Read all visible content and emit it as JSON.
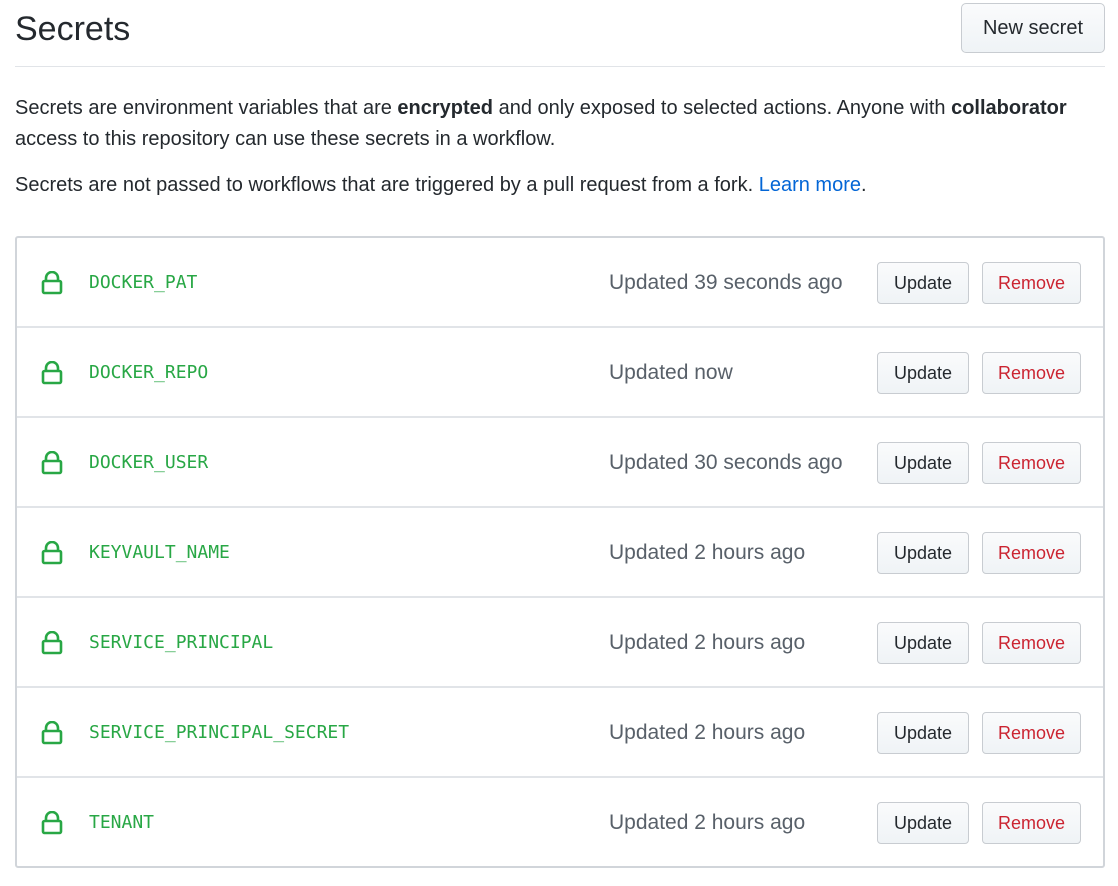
{
  "header": {
    "title": "Secrets",
    "new_secret_label": "New secret"
  },
  "description": {
    "p1_part1": "Secrets are environment variables that are ",
    "p1_bold1": "encrypted",
    "p1_part2": " and only exposed to selected actions. Anyone with ",
    "p1_bold2": "collaborator",
    "p1_part3": " access to this repository can use these secrets in a workflow.",
    "p2_text": "Secrets are not passed to workflows that are triggered by a pull request from a fork. ",
    "p2_link": "Learn more",
    "p2_end": "."
  },
  "secrets": [
    {
      "name": "DOCKER_PAT",
      "updated": "Updated 39 seconds ago",
      "update_label": "Update",
      "remove_label": "Remove"
    },
    {
      "name": "DOCKER_REPO",
      "updated": "Updated now",
      "update_label": "Update",
      "remove_label": "Remove"
    },
    {
      "name": "DOCKER_USER",
      "updated": "Updated 30 seconds ago",
      "update_label": "Update",
      "remove_label": "Remove"
    },
    {
      "name": "KEYVAULT_NAME",
      "updated": "Updated 2 hours ago",
      "update_label": "Update",
      "remove_label": "Remove"
    },
    {
      "name": "SERVICE_PRINCIPAL",
      "updated": "Updated 2 hours ago",
      "update_label": "Update",
      "remove_label": "Remove"
    },
    {
      "name": "SERVICE_PRINCIPAL_SECRET",
      "updated": "Updated 2 hours ago",
      "update_label": "Update",
      "remove_label": "Remove"
    },
    {
      "name": "TENANT",
      "updated": "Updated 2 hours ago",
      "update_label": "Update",
      "remove_label": "Remove"
    }
  ],
  "icons": {
    "row_icon": "lock-icon"
  },
  "colors": {
    "secret_name": "#28a745",
    "remove_text": "#cb2431",
    "link": "#0366d6"
  }
}
